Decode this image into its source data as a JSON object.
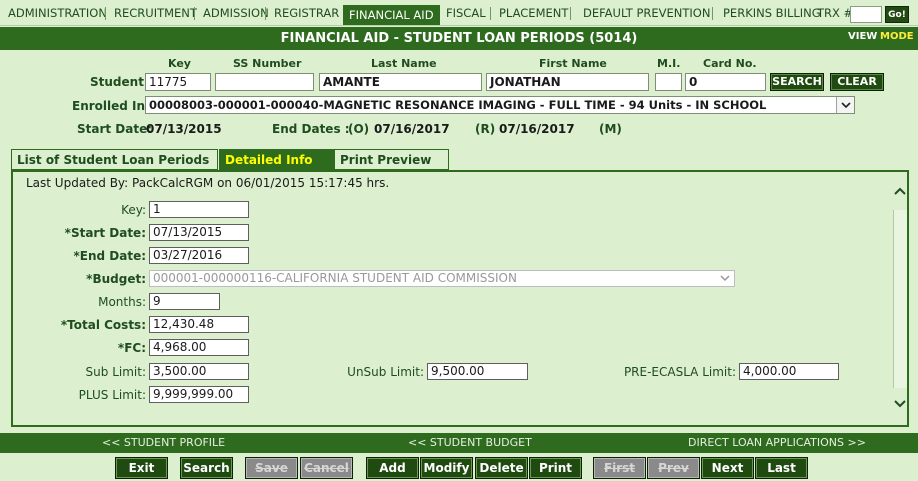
{
  "nav": {
    "items": [
      "ADMINISTRATION",
      "RECRUITMENT",
      "ADMISSION",
      "REGISTRAR",
      "FINANCIAL AID",
      "FISCAL",
      "PLACEMENT",
      "DEFAULT PREVENTION",
      "PERKINS BILLING"
    ],
    "trx_label": "TRX #:",
    "go_label": "Go!"
  },
  "title": "FINANCIAL AID - STUDENT LOAN PERIODS (5014)",
  "mode": {
    "view": "VIEW",
    "mode": "MODE"
  },
  "student": {
    "headers": {
      "key": "Key",
      "ssn": "SS Number",
      "last": "Last Name",
      "first": "First Name",
      "mi": "M.I.",
      "card": "Card No."
    },
    "label": "Student:",
    "key": "11775",
    "ssn": "",
    "last": "AMANTE",
    "first": "JONATHAN",
    "mi": "",
    "card": "0",
    "search_label": "SEARCH",
    "clear_label": "CLEAR"
  },
  "enrolled": {
    "label": "Enrolled In:",
    "value": "00008003-000001-000040-MAGNETIC RESONANCE IMAGING - FULL TIME - 94 Units - IN SCHOOL"
  },
  "dates": {
    "start_label": "Start Date:",
    "start": "07/13/2015",
    "end_label": "End Dates :",
    "o_label": "(O)",
    "o_value": "07/16/2017",
    "r_label": "(R)",
    "r_value": "07/16/2017",
    "m_label": "(M)"
  },
  "tabs": [
    "List of Student Loan Periods",
    "Detailed Info",
    "Print Preview"
  ],
  "detail": {
    "last_updated": "Last Updated By: PackCalcRGM on 06/01/2015 15:17:45 hrs.",
    "key_label": "Key:",
    "key": "1",
    "start_label": "*Start Date:",
    "start": "07/13/2015",
    "end_label": "*End Date:",
    "end": "03/27/2016",
    "budget_label": "*Budget:",
    "budget": "000001-000000116-CALIFORNIA STUDENT AID COMMISSION",
    "months_label": "Months:",
    "months": "9",
    "total_label": "*Total Costs:",
    "total": "12,430.48",
    "fc_label": "*FC:",
    "fc": "4,968.00",
    "sub_label": "Sub Limit:",
    "sub": "3,500.00",
    "unsub_label": "UnSub Limit:",
    "unsub": "9,500.00",
    "preecasla_label": "PRE-ECASLA Limit:",
    "preecasla": "4,000.00",
    "plus_label": "PLUS Limit:",
    "plus": "9,999,999.00"
  },
  "footer": {
    "student_profile": "<< STUDENT PROFILE",
    "student_budget": "<< STUDENT BUDGET",
    "direct_loan": "DIRECT LOAN APPLICATIONS >>"
  },
  "actions": {
    "exit": "Exit",
    "search": "Search",
    "save": "Save",
    "cancel": "Cancel",
    "add": "Add",
    "modify": "Modify",
    "delete": "Delete",
    "print": "Print",
    "first": "First",
    "prev": "Prev",
    "next": "Next",
    "last": "Last"
  },
  "colors": {
    "primary": "#2f6b1f",
    "background": "#dcefcf",
    "active_tab_text": "#ffff00",
    "mode_text": "#ffeb3b"
  }
}
